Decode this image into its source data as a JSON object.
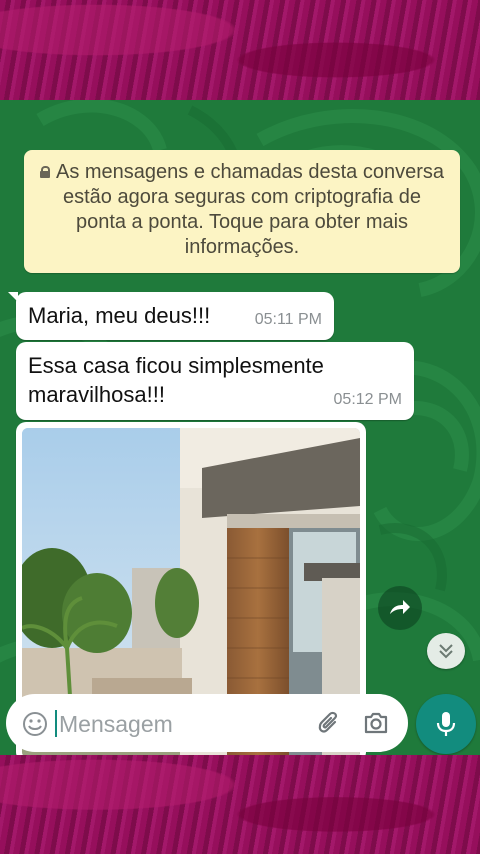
{
  "encryption_notice": {
    "text": "As mensagens e chamadas desta conversa estão agora seguras com criptografia de ponta a ponta. Toque para obter mais informações."
  },
  "messages": [
    {
      "text": "Maria, meu deus!!!",
      "time": "05:11 PM"
    },
    {
      "text": "Essa casa ficou simplesmente maravilhosa!!!",
      "time": "05:12 PM"
    }
  ],
  "image_message": {
    "icon": "house-photo"
  },
  "input_bar": {
    "placeholder": "Mensagem",
    "value": "",
    "icons": [
      "emoji-icon",
      "paperclip-icon",
      "camera-icon",
      "mic-icon"
    ]
  },
  "colors": {
    "chat_background": "#1f7a3b",
    "notice_background": "#fcf4c4",
    "accent": "#128c7e",
    "frame": "#8c1055"
  }
}
